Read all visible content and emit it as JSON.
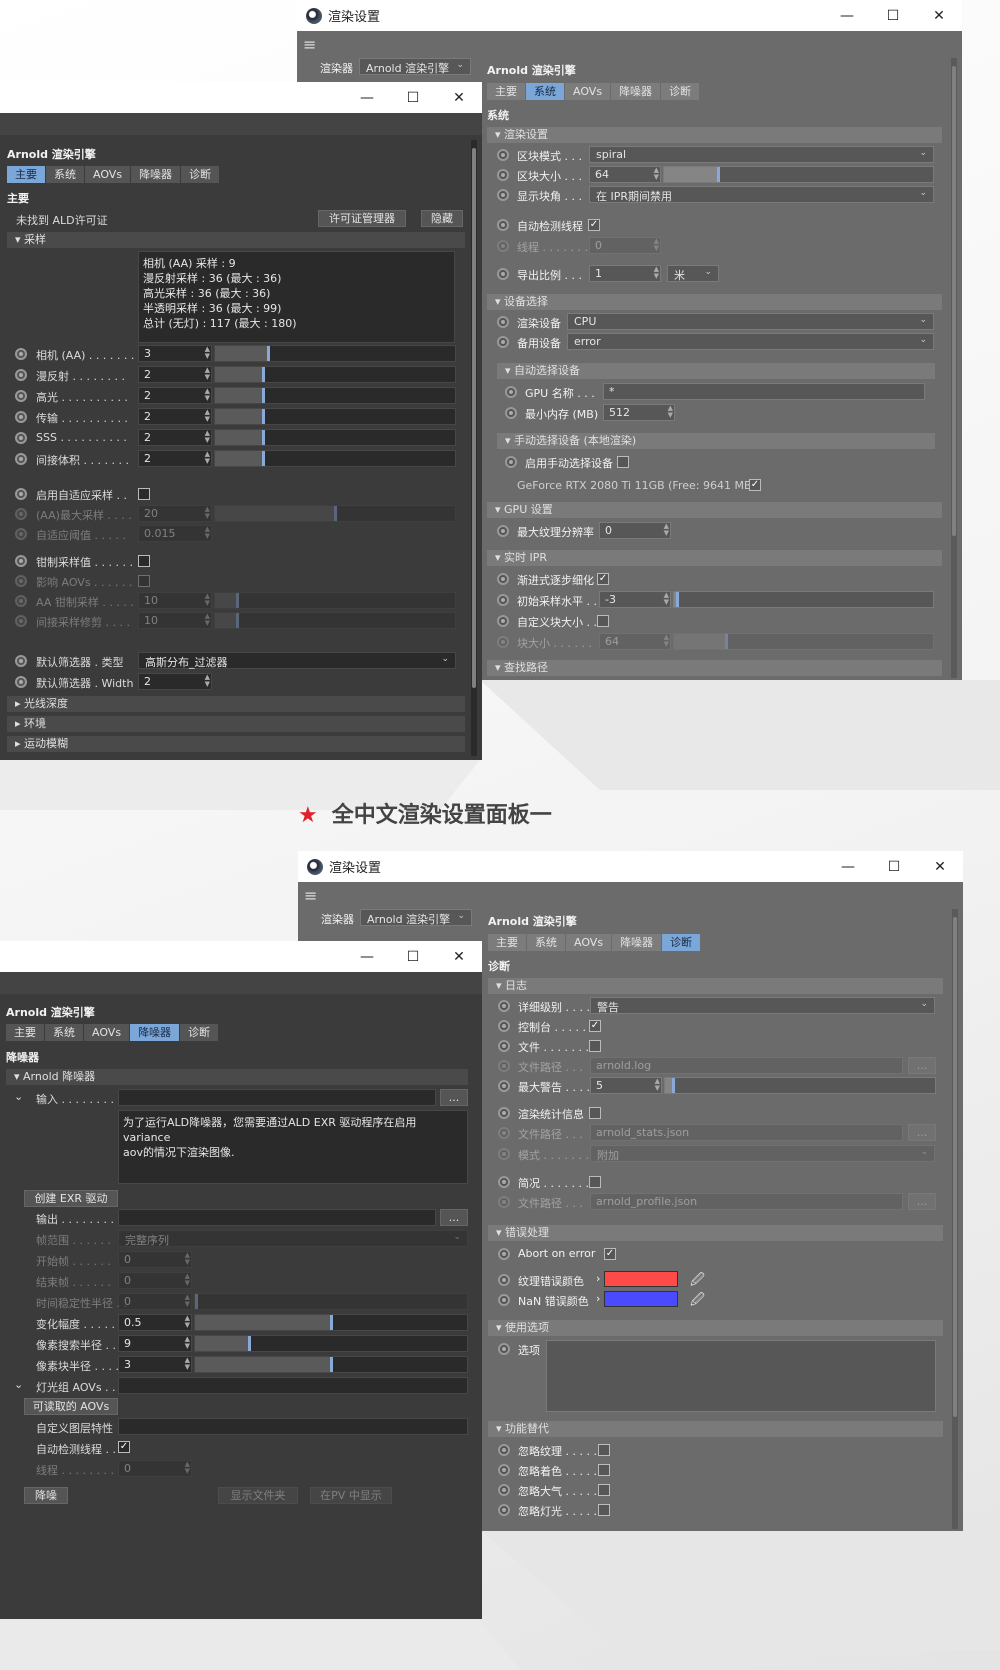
{
  "title": "全中文渲染设置面板一",
  "star": "★",
  "win_title": "渲染设置",
  "win_controls": {
    "min": "—",
    "max": "☐",
    "close": "✕"
  },
  "hamburger": "≡",
  "renderer_label": "渲染器",
  "renderer_value": "Arnold 渲染引擎",
  "engine_heading": "Arnold 渲染引擎",
  "tabs": [
    "主要",
    "系统",
    "AOVs",
    "降噪器",
    "诊断"
  ],
  "w1": {
    "section": "系统",
    "g1": "渲染设置",
    "bucket_mode": {
      "label": "区块模式 . . .",
      "value": "spiral"
    },
    "bucket_size": {
      "label": "区块大小 . . .",
      "value": "64",
      "fill": 0.2
    },
    "display_bucket": {
      "label": "显示块角 . . .",
      "value": "在 IPR期间禁用"
    },
    "auto_threads": {
      "label": "自动检测线程",
      "checked": "✓"
    },
    "threads": {
      "label": "线程 . . . . . . .",
      "value": "0"
    },
    "export_scale": {
      "label": "导出比例 . . .",
      "value": "1",
      "unit": "米"
    },
    "g2": "设备选择",
    "render_device": {
      "label": "渲染设备",
      "value": "CPU"
    },
    "fallback_device": {
      "label": "备用设备",
      "value": "error"
    },
    "g3": "自动选择设备",
    "gpu_name": {
      "label": "GPU 名称 . . .",
      "value": "*"
    },
    "min_mem": {
      "label": "最小内存 (MB)",
      "value": "512"
    },
    "g4": "手动选择设备 (本地渲染)",
    "manual": {
      "label": "启用手动选择设备"
    },
    "gpu_card": {
      "label": "GeForce RTX 2080 Ti 11GB (Free: 9641 MB)",
      "checked": "✓"
    },
    "g5": "GPU 设置",
    "max_tex": {
      "label": "最大纹理分辨率",
      "value": "0"
    },
    "g6": "实时 IPR",
    "progressive": {
      "label": "渐进式逐步细化",
      "checked": "✓"
    },
    "init_level": {
      "label": "初始采样水平 . .",
      "value": "-3",
      "fill": 0.01
    },
    "custom_bucket": {
      "label": "自定义块大小 . ."
    },
    "block_size": {
      "label": "块大小 . . . . . .",
      "value": "64",
      "fill": 0.2
    },
    "g7": "查找路径"
  },
  "w2": {
    "section": "主要",
    "license_text": "未找到 ALD许可证",
    "license_btn": "许可证管理器",
    "hide_btn": "隐藏",
    "sampling": "采样",
    "summary": "相机 (AA) 采样 : 9\n漫反射采样 : 36 (最大 : 36)\n高光采样 : 36 (最大 : 36)\n半透明采样 : 36 (最大 : 99)\n总计 (无灯) : 117 (最大 : 180)",
    "samples": [
      {
        "label": "相机 (AA)  . . . . . . .",
        "value": "3",
        "fill": 0.22
      },
      {
        "label": "漫反射 . . . . . . . .",
        "value": "2",
        "fill": 0.2
      },
      {
        "label": "高光 . . . . . . . . . .",
        "value": "2",
        "fill": 0.2
      },
      {
        "label": "传输 . . . . . . . . . .",
        "value": "2",
        "fill": 0.2
      },
      {
        "label": "SSS  . . . . . . . . . .",
        "value": "2",
        "fill": 0.2
      },
      {
        "label": "间接体积 . . . . . . .",
        "value": "2",
        "fill": 0.2
      }
    ],
    "adaptive": {
      "label": "启用自适应采样 . ."
    },
    "aa_max": {
      "label": "(AA)最大采样 . . . .",
      "value": "20",
      "fill": 0.5
    },
    "adaptive_thr": {
      "label": "自适应阈值 . . . . .",
      "value": "0.015"
    },
    "clamp": {
      "label": "钳制采样值 . . . . . ."
    },
    "affect_aov": {
      "label": "影响 AOVs . . . . . ."
    },
    "aa_clamp": {
      "label": "AA 钳制采样 . . . . .",
      "value": "10",
      "fill": 0.09
    },
    "indirect_clamp": {
      "label": "间接采样修剪 . . . .",
      "value": "10",
      "fill": 0.09
    },
    "filter_type": {
      "label": "默认筛选器 . 类型",
      "value": "高斯分布_过滤器"
    },
    "filter_width": {
      "label": "默认筛选器 . Width",
      "value": "2"
    },
    "collapsed": [
      "光线深度",
      "环境",
      "运动模糊"
    ]
  },
  "w3": {
    "section": "诊断",
    "g1": "日志",
    "verbosity": {
      "label": "详细级别 . . . .",
      "value": "警告"
    },
    "console": {
      "label": "控制台 . . . . .",
      "checked": "✓"
    },
    "file": {
      "label": "文件 . . . . . . ."
    },
    "log_path": {
      "label": "文件路径 . . .",
      "value": "arnold.log",
      "btn": "..."
    },
    "max_warn": {
      "label": "最大警告 . . . .",
      "value": "5",
      "fill": 0.03
    },
    "stats": {
      "label": "渲染统计信息"
    },
    "stats_path": {
      "label": "文件路径 . . .",
      "value": "arnold_stats.json",
      "btn": "..."
    },
    "mode": {
      "label": "模式 . . . . . . .",
      "value": "附加"
    },
    "profile": {
      "label": "简况 . . . . . . . ."
    },
    "profile_path": {
      "label": "文件路径 . . .",
      "value": "arnold_profile.json",
      "btn": "..."
    },
    "g2": "错误处理",
    "abort": {
      "label": "Abort on error",
      "checked": "✓"
    },
    "tex_color": {
      "label": "纹理错误颜色",
      "color": "#ff4a4a"
    },
    "nan_color": {
      "label": "NaN 错误颜色",
      "color": "#4a4aff"
    },
    "g3": "使用选项",
    "options": {
      "label": "选项"
    },
    "g4": "功能替代",
    "overrides": [
      "忽略纹理 . . . . .",
      "忽略着色 . . . . .",
      "忽略大气 . . . . .",
      "忽略灯光 . . . . ."
    ]
  },
  "w4": {
    "section": "降噪器",
    "group": "Arnold 降噪器",
    "input": {
      "label": "输入 . . . . . . . .",
      "btn": "..."
    },
    "msg": "为了运行ALD降噪器，您需要通过ALD EXR 驱动程序在启用variance\naov的情况下渲染图像.",
    "create_btn": "创建 EXR 驱动",
    "output": {
      "label": "输出 . . . . . . . .",
      "btn": "..."
    },
    "frame_range": {
      "label": "帧范围 . . . . . .",
      "value": "完整序列"
    },
    "start": {
      "label": "开始帧 . . . . . .",
      "value": "0"
    },
    "end": {
      "label": "结束帧 . . . . . .",
      "value": "0"
    },
    "temporal": {
      "label": "时间稳定性半径 . .",
      "value": "0",
      "fill": 0.005
    },
    "variance": {
      "label": "变化幅度 . . . . .",
      "value": "0.5",
      "fill": 0.5
    },
    "pixel_search": {
      "label": "像素搜索半径 . . .",
      "value": "9",
      "fill": 0.2
    },
    "pixel_patch": {
      "label": "像素块半径 . . . .",
      "value": "3",
      "fill": 0.5
    },
    "light_aov": {
      "label": "灯光组 AOVs . . ."
    },
    "readable_btn": "可读取的 AOVs",
    "custom_layer": {
      "label": "自定义图层特性"
    },
    "auto_threads": {
      "label": "自动检测线程 . .",
      "checked": "✓"
    },
    "threads": {
      "label": "线程 . . . . . . . .",
      "value": "0"
    },
    "denoise_btn": "降噪",
    "show_folder_btn": "显示文件夹",
    "pv_btn": "在PV 中显示"
  }
}
